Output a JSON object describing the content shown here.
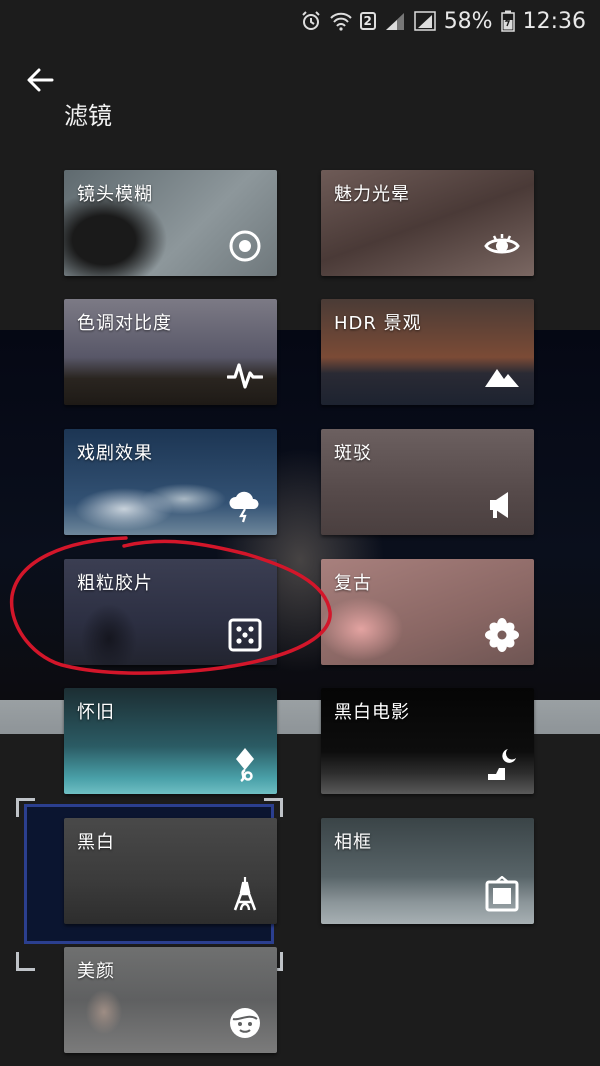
{
  "status_bar": {
    "sim_slot": "2",
    "battery": "58%",
    "time": "12:36"
  },
  "header": {
    "title": "滤镜"
  },
  "filters": [
    {
      "label": "镜头模糊",
      "icon": "lens-blur-icon"
    },
    {
      "label": "魅力光晕",
      "icon": "eye-icon"
    },
    {
      "label": "色调对比度",
      "icon": "pulse-icon"
    },
    {
      "label": "HDR 景观",
      "icon": "mountain-icon"
    },
    {
      "label": "戏剧效果",
      "icon": "storm-cloud-icon"
    },
    {
      "label": "斑驳",
      "icon": "megaphone-icon"
    },
    {
      "label": "粗粒胶片",
      "icon": "dice-icon"
    },
    {
      "label": "复古",
      "icon": "flower-icon"
    },
    {
      "label": "怀旧",
      "icon": "kite-icon"
    },
    {
      "label": "黑白电影",
      "icon": "moon-icon"
    },
    {
      "label": "黑白",
      "icon": "eiffel-tower-icon"
    },
    {
      "label": "相框",
      "icon": "frame-icon"
    },
    {
      "label": "美颜",
      "icon": "face-icon"
    }
  ],
  "colors": {
    "background": "#1c1c1c",
    "annotation": "#d3162a",
    "selection_frame": "#2b3f8f"
  }
}
